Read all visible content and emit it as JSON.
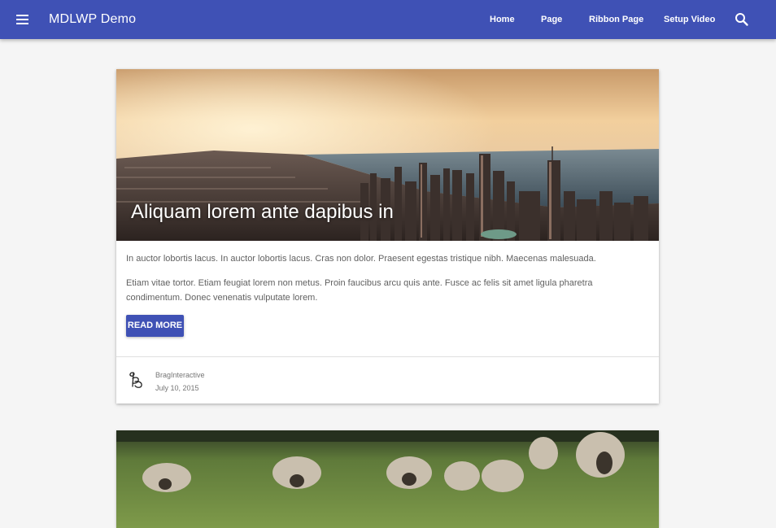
{
  "header": {
    "site_title": "MDLWP Demo",
    "nav": [
      "Home",
      "Page",
      "Ribbon Page",
      "Setup Video"
    ],
    "accent_color": "#3f51b5",
    "menu_icon": "hamburger-menu-icon",
    "search_icon": "search-icon"
  },
  "post": {
    "title": "Aliquam lorem ante dapibus in",
    "paragraph1": "In auctor lobortis lacus. In auctor lobortis lacus. Cras non dolor. Praesent egestas tristique nibh. Maecenas malesuada.",
    "paragraph2": "Etiam vitae tortor. Etiam feugiat lorem non metus. Proin faucibus arcu quis ante. Fusce ac felis sit amet ligula pharetra condimentum. Donec venenatis vulputate lorem.",
    "read_more": "READ MORE",
    "author": "BragInteractive",
    "date": "July 10, 2015",
    "image": "city-skyline-sunset"
  },
  "next_post": {
    "image": "sheep-in-field"
  }
}
